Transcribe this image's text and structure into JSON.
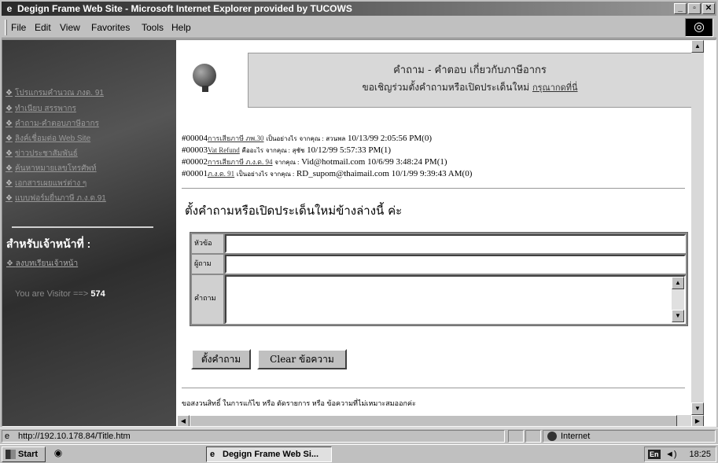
{
  "window": {
    "title": "Degign Frame Web Site - Microsoft Internet Explorer provided by TUCOWS"
  },
  "menu": {
    "file": "File",
    "edit": "Edit",
    "view": "View",
    "favorites": "Favorites",
    "tools": "Tools",
    "help": "Help"
  },
  "sidebar": {
    "items": [
      {
        "label": "โปรแกรมคำนวณ ภงด. 91"
      },
      {
        "label": "ทำเนียบ สรรพากร"
      },
      {
        "label": "คำถาม-คำตอบภาษีอากร"
      },
      {
        "label": "ลิงค์เชื่อมต่อ Web Site"
      },
      {
        "label": "ข่าวประชาสัมพันธ์"
      },
      {
        "label": "ค้นหาหมายเลขโทรศัพท์"
      },
      {
        "label": "เอกสารเผยแพร่ต่าง ๆ"
      },
      {
        "label": "แบบฟอร์มยื่นภาษี ภ.ง.ด.91"
      }
    ],
    "staff_heading": "สำหรับเจ้าหน้าที่ :",
    "staff_link": "ลงบทเรียนเจ้าหน้า",
    "visitor_label": "You are Visitor ==>",
    "visitor_count": "574"
  },
  "banner": {
    "line1": "คำถาม - คำตอบ เกี่ยวกับภาษีอากร",
    "line2": "ขอเชิญร่วมตั้งคำถามหรือเปิดประเด็นใหม่",
    "line2_link": "กรุณากดที่นี่"
  },
  "posts": [
    {
      "id": "#00004",
      "topic": "การเสียภาษี ภพ.30",
      "suffix": "เป็นอย่างไร",
      "from_label": "จากคุณ :",
      "author": "สวนพล",
      "date": "10/13/99 2:05:56 PM(0)"
    },
    {
      "id": "#00003",
      "topic": "Vat Refund",
      "suffix": "คืออะไร",
      "from_label": "จากคุณ :",
      "author": "สุชัช",
      "date": "10/12/99 5:57:33 PM(1)"
    },
    {
      "id": "#00002",
      "topic": "การเสียภาษี ภ.ง.ด. 94",
      "suffix": "",
      "from_label": "จากคุณ :",
      "author": "Vid@hotmail.com",
      "date": "10/6/99 3:48:24 PM(1)"
    },
    {
      "id": "#00001",
      "topic": "ภ.ง.ด. 91",
      "suffix": "เป็นอย่างไร",
      "from_label": "จากคุณ :",
      "author": "RD_supom@thaimail.com",
      "date": "10/1/99 9:39:43 AM(0)"
    }
  ],
  "form": {
    "heading": "ตั้งคำถามหรือเปิดประเด็นใหม่ข้างล่างนี้ ค่ะ",
    "subject_label": "หัวข้อ",
    "subject_value": "",
    "author_label": "ผู้ถาม",
    "author_value": "",
    "question_label": "คำถาม",
    "question_value": "",
    "submit_label": "ตั้งคำถาม",
    "clear_label": "Clear ข้อความ"
  },
  "footer_note": "ขอสงวนสิทธิ์ ในการแก้ไข หรือ ตัดรายการ หรือ ข้อความที่ไม่เหมาะสมออกค่ะ",
  "status": {
    "url": "http://192.10.178.84/Title.htm",
    "zone": "Internet"
  },
  "taskbar": {
    "start": "Start",
    "task": "Degign Frame Web Si...",
    "lang": "En",
    "clock": "18:25"
  }
}
